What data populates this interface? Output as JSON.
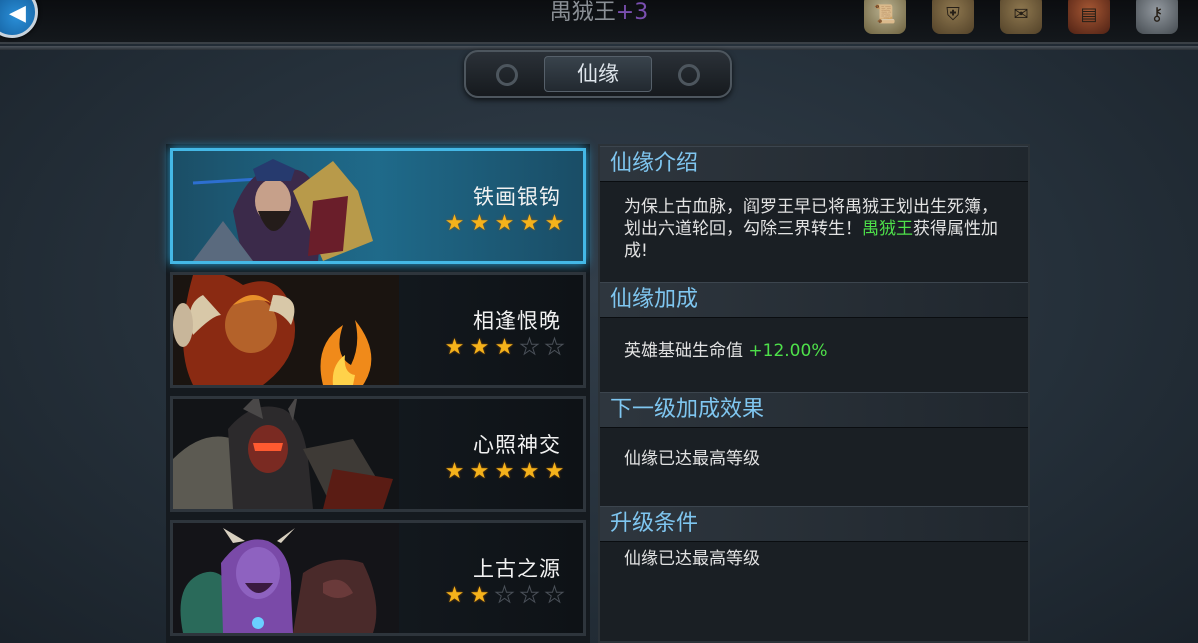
{
  "header": {
    "hero_name": "禺狨王",
    "hero_plus": "+3",
    "panel_title": "仙缘"
  },
  "fates": [
    {
      "name": "铁画银钩",
      "stars": 5,
      "max_stars": 5,
      "selected": true
    },
    {
      "name": "相逢恨晚",
      "stars": 3,
      "max_stars": 5,
      "selected": false
    },
    {
      "name": "心照神交",
      "stars": 5,
      "max_stars": 5,
      "selected": false
    },
    {
      "name": "上古之源",
      "stars": 2,
      "max_stars": 5,
      "selected": false
    }
  ],
  "info": {
    "intro_title": "仙缘介绍",
    "intro_text": "为保上古血脉，阎罗王早已将禺狨王划出生死簿，划出六道轮回，勾除三界转生！",
    "intro_highlight": "禺狨王",
    "intro_tail": "获得属性加成!",
    "bonus_title": "仙缘加成",
    "bonus_label": "英雄基础生命值 ",
    "bonus_value": "+12.00%",
    "next_title": "下一级加成效果",
    "next_text": "仙缘已达最高等级",
    "upgrade_title": "升级条件",
    "upgrade_text": "仙缘已达最高等级"
  },
  "colors": {
    "header_text": "#7fc6f0",
    "highlight_green": "#4ee04a",
    "star_gold": "#f5b21b",
    "selected_border": "#44b8e6"
  }
}
